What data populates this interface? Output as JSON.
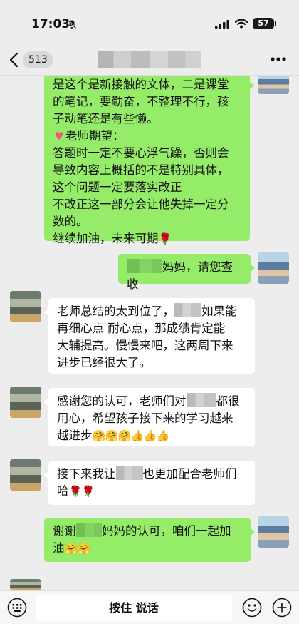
{
  "status": {
    "time": "17:03",
    "battery": "57"
  },
  "nav": {
    "back_count": "513"
  },
  "messages": [
    {
      "side": "right",
      "lines": [
        "是这个是新接触的文体，二是课堂",
        "的笔记，要勤奋，不整理不行，孩",
        "子动笔还是有些懒。",
        "老师期望：",
        "答题时一定不要心浮气躁，否则会",
        "导致内容上概括的不是特别具体，",
        "这个问题一定要落实改正",
        "不改正这一部分会让他失掉一定分",
        "数的。",
        "继续加油，未来可期"
      ]
    },
    {
      "side": "right",
      "text": "妈妈，请您查收"
    },
    {
      "side": "left",
      "lines": [
        "老师总结的太到位了，",
        "如果能",
        "再细心点 耐心点，那成绩肯定能",
        "大辅提高。慢慢来吧，这两周下来",
        "进步已经很大了。"
      ]
    },
    {
      "side": "left",
      "lines": [
        "感谢您的认可，老师们对",
        "都很",
        "用心，希望孩子接下来的学习越来",
        "越进步"
      ]
    },
    {
      "side": "left",
      "lines": [
        "接下来我让",
        "也更加配合老师们",
        "哈"
      ]
    },
    {
      "side": "right",
      "lines": [
        "谢谢",
        "妈妈的认可，咱们一起加",
        "油"
      ]
    }
  ],
  "input": {
    "hold_to_talk": "按住 说话"
  },
  "colors": {
    "green_bubble": "#95ec69",
    "white_bubble": "#ffffff",
    "background": "#ededed"
  },
  "icons": [
    "bell-slash-icon",
    "signal-icon",
    "wifi-icon",
    "back-icon",
    "more-icon",
    "voice-icon",
    "emoji-icon",
    "plus-icon",
    "rose-emoji",
    "heart-emoji",
    "hug-emoji",
    "thumbs-up-emoji"
  ]
}
